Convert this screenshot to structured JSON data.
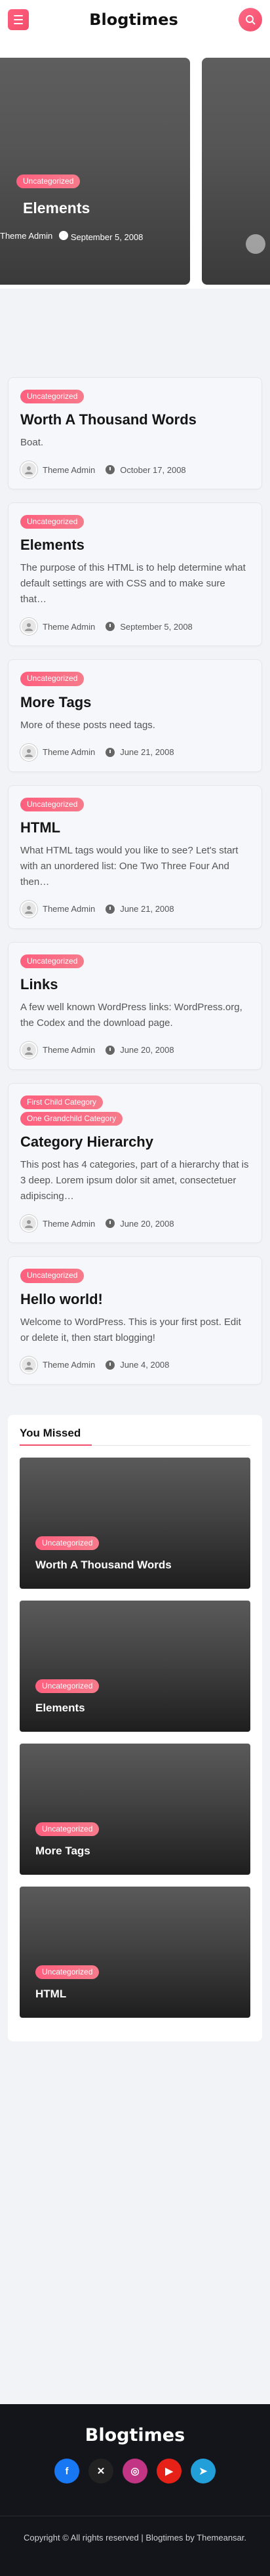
{
  "site": {
    "title": "Blogtimes"
  },
  "hero": {
    "slide": {
      "category": "Uncategorized",
      "title": "Elements",
      "author": "Theme Admin",
      "date": "September 5, 2008"
    }
  },
  "posts": [
    {
      "categories": [
        "Uncategorized"
      ],
      "title": "Worth A Thousand Words",
      "excerpt": "Boat.",
      "author": "Theme Admin",
      "date": "October 17, 2008"
    },
    {
      "categories": [
        "Uncategorized"
      ],
      "title": "Elements",
      "excerpt": "The purpose of this HTML is to help determine what default settings are with CSS and to make sure that…",
      "author": "Theme Admin",
      "date": "September 5, 2008"
    },
    {
      "categories": [
        "Uncategorized"
      ],
      "title": "More Tags",
      "excerpt": "More of these posts need tags.",
      "author": "Theme Admin",
      "date": "June 21, 2008"
    },
    {
      "categories": [
        "Uncategorized"
      ],
      "title": "HTML",
      "excerpt": "What HTML tags would you like to see? Let's start with an unordered list: One Two Three Four And then…",
      "author": "Theme Admin",
      "date": "June 21, 2008"
    },
    {
      "categories": [
        "Uncategorized"
      ],
      "title": "Links",
      "excerpt": "A few well known WordPress links: WordPress.org, the Codex and the download page.",
      "author": "Theme Admin",
      "date": "June 20, 2008"
    },
    {
      "categories": [
        "First Child Category",
        "One Grandchild Category"
      ],
      "title": "Category Hierarchy",
      "excerpt": "This post has 4 categories, part of a hierarchy that is 3 deep. Lorem ipsum dolor sit amet, consectetuer adipiscing…",
      "author": "Theme Admin",
      "date": "June 20, 2008"
    },
    {
      "categories": [
        "Uncategorized"
      ],
      "title": "Hello world!",
      "excerpt": "Welcome to WordPress. This is your first post. Edit or delete it, then start blogging!",
      "author": "Theme Admin",
      "date": "June 4, 2008"
    }
  ],
  "missed": {
    "heading": "You Missed",
    "items": [
      {
        "category": "Uncategorized",
        "title": "Worth A Thousand Words"
      },
      {
        "category": "Uncategorized",
        "title": "Elements"
      },
      {
        "category": "Uncategorized",
        "title": "More Tags"
      },
      {
        "category": "Uncategorized",
        "title": "HTML"
      }
    ]
  },
  "footer": {
    "title": "Blogtimes",
    "socials": [
      {
        "icon": "facebook-icon",
        "glyph": "f",
        "color": "#1877f2"
      },
      {
        "icon": "x-icon",
        "glyph": "✕",
        "color": "#222222"
      },
      {
        "icon": "instagram-icon",
        "glyph": "◎",
        "color": "#c13584"
      },
      {
        "icon": "youtube-icon",
        "glyph": "▶",
        "color": "#e62117"
      },
      {
        "icon": "telegram-icon",
        "glyph": "➤",
        "color": "#229ed9"
      }
    ],
    "copyright": "Copyright © All rights reserved | Blogtimes by Themeansar."
  },
  "colors": {
    "accent": "#f24e6b",
    "footer_bg": "#14151a"
  }
}
